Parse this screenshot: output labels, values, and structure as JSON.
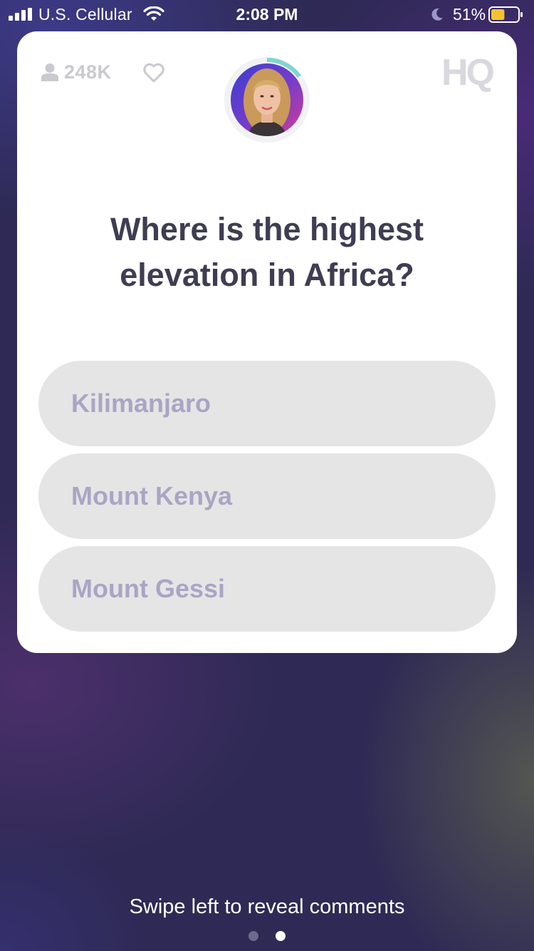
{
  "status_bar": {
    "carrier": "U.S. Cellular",
    "time": "2:08 PM",
    "battery_percent": "51%",
    "battery_level": 0.51,
    "battery_color": "#f2c331",
    "signal_bars": 4,
    "icons": [
      "signal-icon",
      "wifi-icon",
      "moon-icon",
      "battery-icon"
    ]
  },
  "game": {
    "viewer_count": "248K",
    "logo": "HQ",
    "timer_progress": 0.15,
    "timer_color": "#7ed6d2",
    "icons": [
      "person-icon",
      "heart-icon"
    ],
    "question": "Where is the highest elevation in Africa?",
    "answers": [
      {
        "label": "Kilimanjaro"
      },
      {
        "label": "Mount Kenya"
      },
      {
        "label": "Mount Gessi"
      }
    ]
  },
  "footer": {
    "swipe_hint": "Swipe left to reveal comments",
    "pages": 2,
    "active_page": 2
  },
  "colors": {
    "card_bg": "#ffffff",
    "answer_bg": "#e5e5e5",
    "answer_text": "#aaa5c4",
    "question_text": "#3f3d52"
  }
}
